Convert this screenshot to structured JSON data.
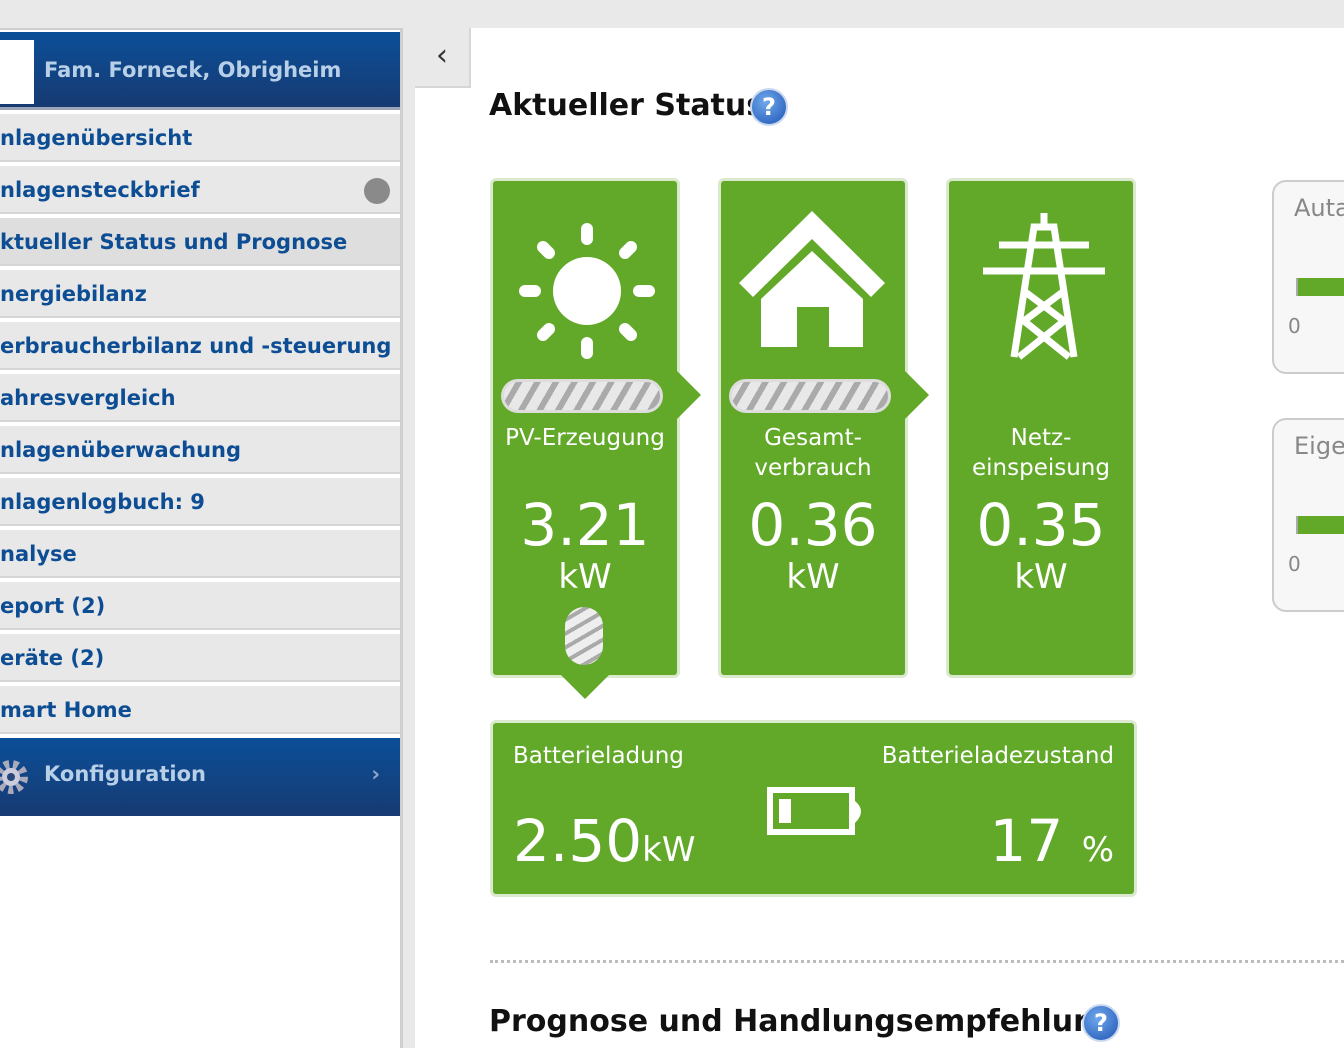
{
  "sidebar": {
    "title": "Fam. Forneck, Obrigheim",
    "items": [
      {
        "label": "nlagenübersicht"
      },
      {
        "label": "nlagensteckbrief"
      },
      {
        "label": "ktueller Status und Prognose"
      },
      {
        "label": "nergiebilanz"
      },
      {
        "label": "erbraucherbilanz und -steuerung"
      },
      {
        "label": "ahresvergleich"
      },
      {
        "label": "nlagenüberwachung"
      },
      {
        "label": "nlagenlogbuch: 9"
      },
      {
        "label": "nalyse"
      },
      {
        "label": "eport (2)"
      },
      {
        "label": "eräte (2)"
      },
      {
        "label": "mart Home"
      }
    ],
    "config_label": "Konfiguration"
  },
  "main": {
    "status_title": "Aktueller Status",
    "forecast_title": "Prognose und Handlungsempfehlung",
    "cards": [
      {
        "label": "PV-Erzeugung",
        "value": "3.21",
        "unit": "kW"
      },
      {
        "label": "Gesamt-\nverbrauch",
        "value": "0.36",
        "unit": "kW"
      },
      {
        "label": "Netz-\neinspeisung",
        "value": "0.35",
        "unit": "kW"
      }
    ],
    "battery": {
      "charge_label": "Batterieladung",
      "charge_value": "2.50",
      "charge_unit": "kW",
      "soc_label": "Batterieladezustand",
      "soc_value": "17",
      "soc_unit": "%"
    },
    "side_panels": [
      {
        "title": "Auta",
        "zero": "0"
      },
      {
        "title": "Eige",
        "zero": "0"
      }
    ]
  },
  "colors": {
    "green": "#62a829",
    "blue": "#0b4f98"
  }
}
